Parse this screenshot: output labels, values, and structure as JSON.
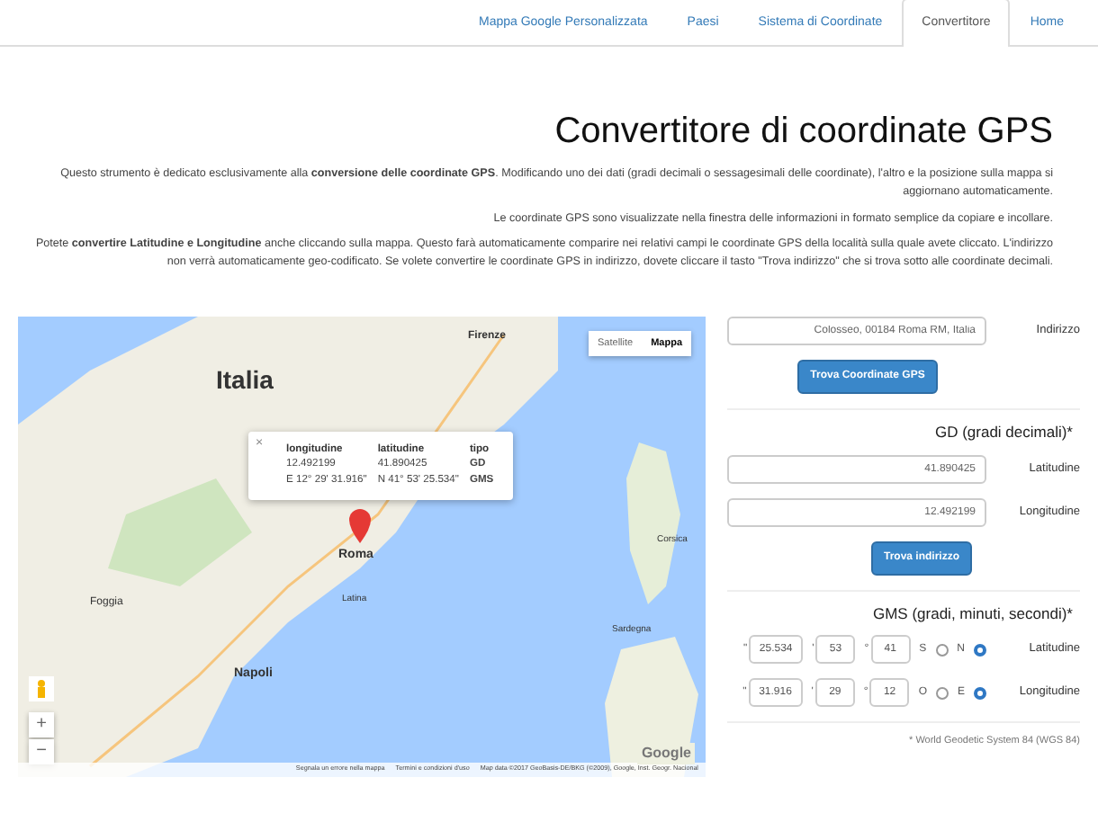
{
  "tabs": [
    {
      "label": "Mappa Google Personalizzata",
      "selected": false
    },
    {
      "label": "Paesi",
      "selected": false
    },
    {
      "label": "Sistema di Coordinate",
      "selected": false
    },
    {
      "label": "Convertitore",
      "selected": true
    },
    {
      "label": "Home",
      "selected": false
    }
  ],
  "heading": "Convertitore di coordinate GPS",
  "paragraphs": [
    "Questo strumento è dedicato esclusivamente alla **conversione delle coordinate GPS**. Modificando uno dei dati (gradi decimali o sessagesimali delle coordinate), l'altro e la posizione sulla mappa si aggiornano automaticamente.",
    "Le coordinate GPS sono visualizzate nella finestra delle informazioni in formato semplice da copiare e incollare.",
    "Potete **convertire Latitudine e Longitudine** anche cliccando sulla mappa. Questo farà automaticamente comparire nei relativi campi le coordinate GPS della località sulla quale avete cliccato. L'indirizzo non verrà automaticamente geo-codificato. Se volete convertire le coordinate GPS in indirizzo, dovete cliccare il tasto \"Trova indirizzo\" che si trova sotto alle coordinate decimali."
  ],
  "map": {
    "type_buttons": [
      {
        "label": "Satellite",
        "selected": false
      },
      {
        "label": "Mappa",
        "selected": true
      }
    ],
    "place_labels": [
      "Firenze",
      "Italia",
      "Roma",
      "Napoli",
      "Foggia",
      "Latina",
      "Corsica",
      "Sardegna"
    ],
    "popup": {
      "columns": [
        "longitudine",
        "latitudine",
        "tipo"
      ],
      "rows": [
        [
          "12.492199",
          "41.890425",
          "GD"
        ],
        [
          "E 12° 29' 31.916\"",
          "N 41° 53' 25.534\"",
          "GMS"
        ]
      ],
      "close": "×"
    },
    "zoom_in": "+",
    "zoom_out": "−",
    "logo": "Google",
    "attribution": [
      "Segnala un errore nella mappa",
      "Termini e condizioni d'uso",
      "Map data ©2017 GeoBasis-DE/BKG (©2009), Google, Inst. Geogr. Nacional"
    ]
  },
  "form": {
    "address": {
      "label": "Indirizzo",
      "value": "Colosseo, 00184 Roma RM, Italia"
    },
    "find_gps_button": "Trova Coordinate GPS",
    "gd": {
      "title": "GD (gradi decimali)*",
      "fields": [
        {
          "label": "Latitudine",
          "value": "41.890425"
        },
        {
          "label": "Longitudine",
          "value": "12.492199"
        }
      ],
      "button": "Trova indirizzo"
    },
    "gms": {
      "title": "GMS (gradi, minuti, secondi)*",
      "rows": [
        {
          "label": "Latitudine",
          "hemispheres": [
            {
              "label": "S",
              "selected": false
            },
            {
              "label": "N",
              "selected": true
            }
          ],
          "parts": [
            {
              "unit": "\"",
              "value": "25.534"
            },
            {
              "unit": "'",
              "value": "53"
            },
            {
              "unit": "°",
              "value": "41"
            }
          ]
        },
        {
          "label": "Longitudine",
          "hemispheres": [
            {
              "label": "O",
              "selected": false
            },
            {
              "label": "E",
              "selected": true
            }
          ],
          "parts": [
            {
              "unit": "\"",
              "value": "31.916"
            },
            {
              "unit": "'",
              "value": "29"
            },
            {
              "unit": "°",
              "value": "12"
            }
          ]
        }
      ]
    },
    "footnote": "* World Geodetic System 84 (WGS 84)"
  }
}
